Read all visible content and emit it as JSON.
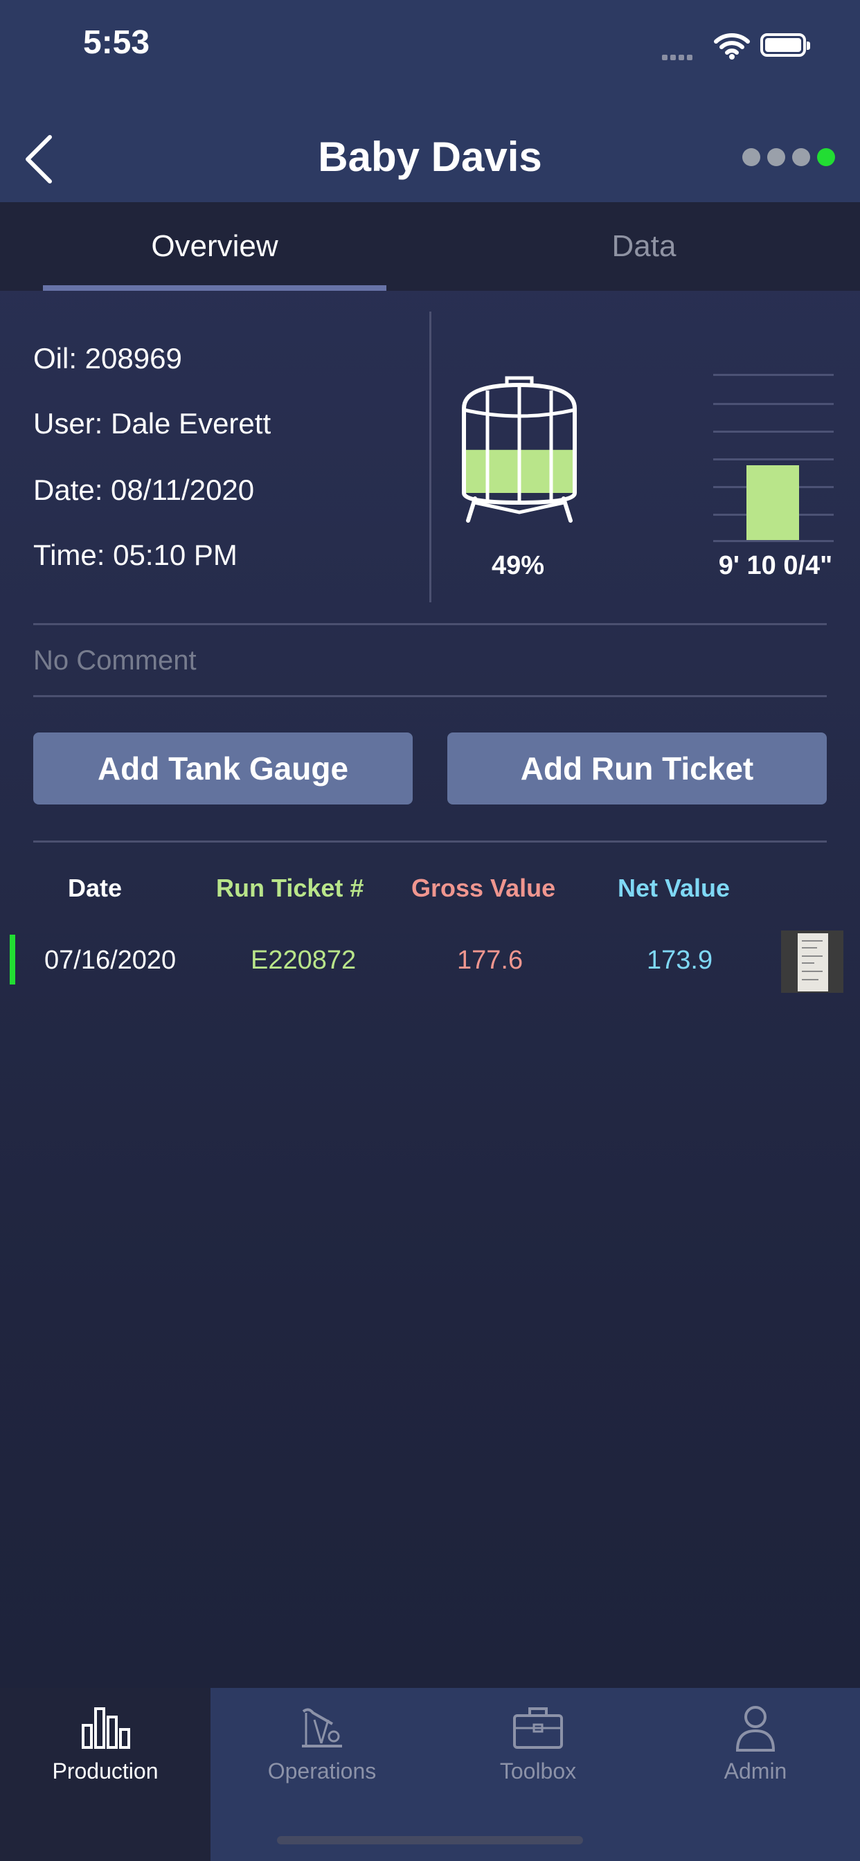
{
  "status": {
    "time": "5:53"
  },
  "header": {
    "title": "Baby Davis",
    "dots": [
      false,
      false,
      false,
      true
    ]
  },
  "tabs": [
    {
      "label": "Overview",
      "active": true
    },
    {
      "label": "Data",
      "active": false
    }
  ],
  "info": {
    "oil": "Oil: 208969",
    "user": "User:  Dale Everett",
    "date": "Date:  08/11/2020",
    "time": "Time:  05:10 PM"
  },
  "tank": {
    "percent_label": "49%",
    "fill_fraction": 0.49
  },
  "gauge": {
    "level_label": "9' 10 0/4\"",
    "fill_fraction": 0.45
  },
  "comment": {
    "placeholder": "No Comment"
  },
  "buttons": {
    "add_tank_gauge": "Add Tank Gauge",
    "add_run_ticket": "Add Run Ticket"
  },
  "table": {
    "headers": {
      "date": "Date",
      "run_ticket": "Run Ticket #",
      "gross": "Gross Value",
      "net": "Net Value"
    },
    "rows": [
      {
        "date": "07/16/2020",
        "run_ticket": "E220872",
        "gross": "177.6",
        "net": "173.9"
      }
    ]
  },
  "colors": {
    "run_ticket": "#b9e58a",
    "gross": "#f0968f",
    "net": "#7fd8f5",
    "tank_fill": "#b9e58a",
    "status_dot": "#22dd33"
  },
  "tabbar": [
    {
      "label": "Production",
      "icon": "bar-chart-icon",
      "active": true
    },
    {
      "label": "Operations",
      "icon": "pump-jack-icon",
      "active": false
    },
    {
      "label": "Toolbox",
      "icon": "toolbox-icon",
      "active": false
    },
    {
      "label": "Admin",
      "icon": "person-icon",
      "active": false
    }
  ]
}
